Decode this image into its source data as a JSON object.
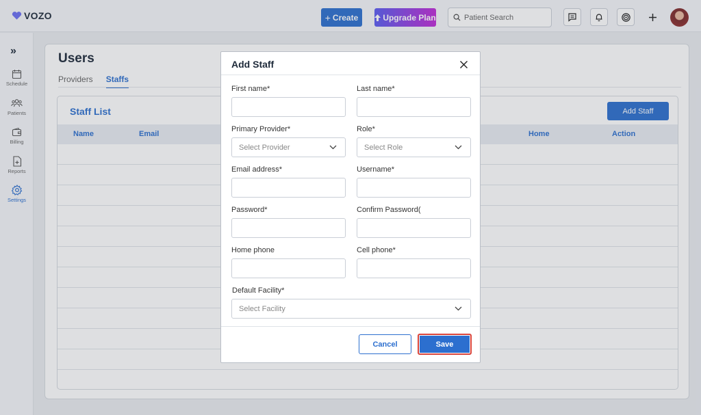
{
  "app": {
    "logo_text": "VOZO"
  },
  "topbar": {
    "create_label": "Create",
    "upgrade_label": "Upgrade Plan",
    "search_placeholder": "Patient Search"
  },
  "sidebar": {
    "items": [
      {
        "label": "Schedule",
        "icon": "calendar-icon"
      },
      {
        "label": "Patients",
        "icon": "users-icon"
      },
      {
        "label": "Billing",
        "icon": "wallet-icon"
      },
      {
        "label": "Reports",
        "icon": "report-icon"
      },
      {
        "label": "Settings",
        "icon": "gear-icon"
      }
    ]
  },
  "page": {
    "title": "Users",
    "tabs": [
      {
        "label": "Providers"
      },
      {
        "label": "Staffs"
      }
    ]
  },
  "staff_list": {
    "title": "Staff List",
    "add_label": "Add Staff",
    "columns": [
      "Name",
      "Email",
      "Home",
      "Action"
    ],
    "row_count": 11
  },
  "modal": {
    "title": "Add Staff",
    "fields": {
      "first_name": {
        "label": "First name*",
        "value": ""
      },
      "last_name": {
        "label": "Last name*",
        "value": ""
      },
      "primary_provider": {
        "label": "Primary Provider*",
        "placeholder": "Select Provider"
      },
      "role": {
        "label": "Role*",
        "placeholder": "Select Role"
      },
      "email": {
        "label": "Email address*",
        "value": ""
      },
      "username": {
        "label": "Username*",
        "value": ""
      },
      "password": {
        "label": "Password*",
        "value": ""
      },
      "confirm_password": {
        "label": "Confirm Password(",
        "value": ""
      },
      "home_phone": {
        "label": "Home phone",
        "value": ""
      },
      "cell_phone": {
        "label": "Cell phone*",
        "value": ""
      },
      "default_facility": {
        "label": "Default Facility*",
        "placeholder": "Select Facility"
      }
    },
    "cancel_label": "Cancel",
    "save_label": "Save"
  },
  "colors": {
    "accent": "#2c6fcf",
    "highlight": "#d9443b"
  }
}
